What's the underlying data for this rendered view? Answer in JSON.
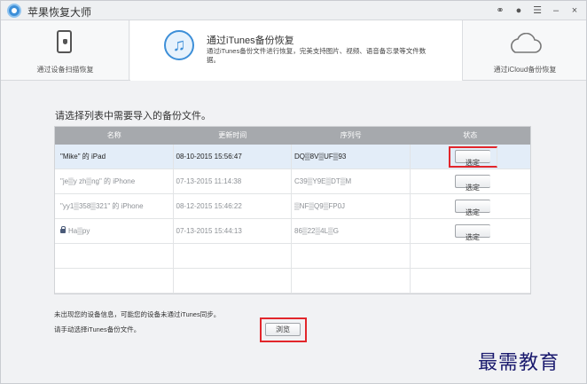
{
  "app": {
    "title": "苹果恢复大师"
  },
  "titlebar": {
    "icons": [
      "weibo-icon",
      "chat-icon",
      "menu-icon",
      "minimize-icon",
      "close-icon"
    ],
    "glyphs": [
      "⚭",
      "●",
      "☰",
      "–",
      "×"
    ]
  },
  "modes": {
    "left": {
      "label": "通过设备扫描恢复"
    },
    "center": {
      "title": "通过iTunes备份恢复",
      "desc": "通过iTunes备份文件进行恢复，完美支持图片、视频、语音备忘录等文件数据。"
    },
    "right": {
      "label": "通过iCloud备份恢复"
    }
  },
  "content": {
    "instruction": "请选择列表中需要导入的备份文件。",
    "columns": [
      "名称",
      "更新时间",
      "序列号",
      "状态"
    ],
    "rows": [
      {
        "name": "\"Mike\" 的 iPad",
        "time": "08-10-2015 15:56:47",
        "serial": "DQ▒8V▒UF▒93",
        "action": "选定"
      },
      {
        "name": "\"je▒y zh▒ng\" 的 iPhone",
        "time": "07-13-2015 11:14:38",
        "serial": "C39▒Y9E▒DT▒M",
        "action": "选定"
      },
      {
        "name": "\"yy1▒358▒321\" 的 iPhone",
        "time": "08-12-2015 15:46:22",
        "serial": "▒NF▒Q9▒FP0J",
        "action": "选定"
      },
      {
        "name": "Ha▒py",
        "time": "07-13-2015 15:44:13",
        "serial": "86▒22▒4L▒G",
        "action": "选定"
      }
    ],
    "notice1": "未出现您的设备信息，可能您的设备未通过iTunes同步。",
    "notice2": "请手动选择iTunes备份文件。",
    "browse_label": "浏览"
  },
  "watermark": "最需教育",
  "colors": {
    "accent": "#3d8fd8",
    "highlight": "#e2262b",
    "header": "#a6a9ad"
  }
}
